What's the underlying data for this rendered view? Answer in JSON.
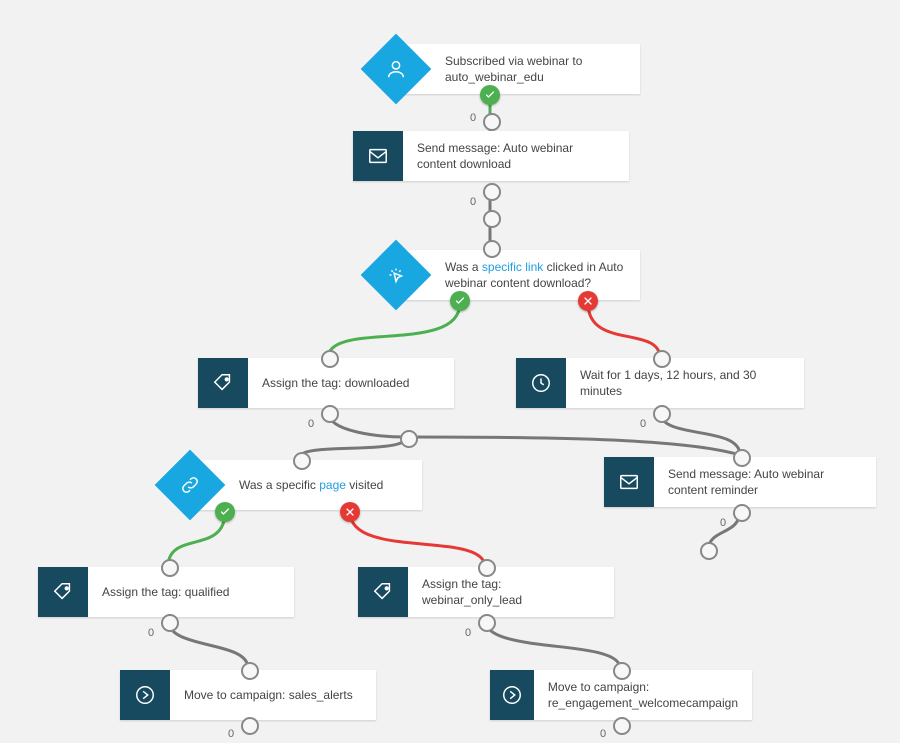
{
  "nodes": {
    "start": {
      "text_before": "Subscribed via webinar to ",
      "highlight": "",
      "text_after": "auto_webinar_edu"
    },
    "msg1": {
      "text_before": "Send message: Auto webinar content download",
      "highlight": "",
      "text_after": ""
    },
    "cond_link": {
      "text_before": "Was a ",
      "highlight": "specific link",
      "text_after": " clicked in Auto webinar content download?"
    },
    "tag_dl": {
      "text_before": "Assign the tag: downloaded",
      "highlight": "",
      "text_after": ""
    },
    "wait": {
      "text_before": "Wait for 1 days, 12 hours, and 30 minutes",
      "highlight": "",
      "text_after": ""
    },
    "cond_page": {
      "text_before": "Was a specific ",
      "highlight": "page",
      "text_after": " visited"
    },
    "msg2": {
      "text_before": "Send message: Auto webinar content reminder",
      "highlight": "",
      "text_after": ""
    },
    "tag_qual": {
      "text_before": "Assign the tag: qualified",
      "highlight": "",
      "text_after": ""
    },
    "tag_wol": {
      "text_before": "Assign the tag: webinar_only_lead",
      "highlight": "",
      "text_after": ""
    },
    "move_sales": {
      "text_before": "Move to campaign: sales_alerts",
      "highlight": "",
      "text_after": ""
    },
    "move_re": {
      "text_before": "Move to campaign: re_engagement_welcomecampaign",
      "highlight": "",
      "text_after": ""
    }
  },
  "wait_label": "0"
}
